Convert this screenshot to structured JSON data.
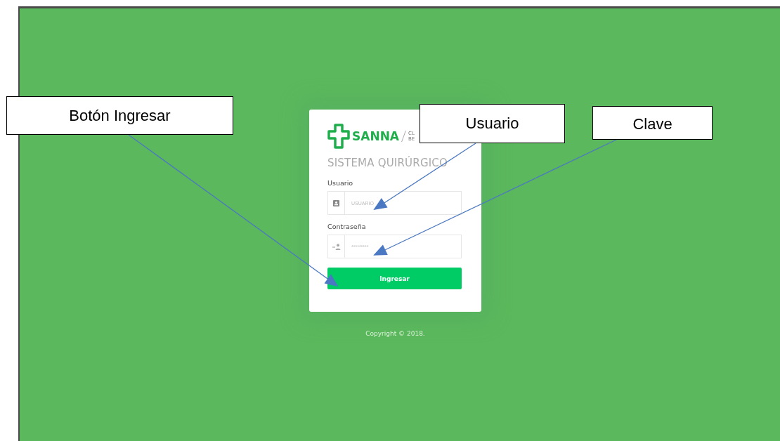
{
  "login": {
    "brand": "SANNA",
    "brand_subtitle_lines": [
      "CL",
      "BE"
    ],
    "system_title": "SISTEMA QUIRÚRGICO",
    "fields": [
      {
        "kind": "user",
        "label": "Usuario",
        "placeholder": "USUARIO"
      },
      {
        "kind": "password",
        "label": "Contraseña",
        "placeholder": "*********"
      }
    ],
    "submit": "Ingresar"
  },
  "copyright": "Copyright © 2018.",
  "callouts": [
    {
      "text": "Botón Ingresar"
    },
    {
      "text": "Usuario"
    },
    {
      "text": "Clave"
    }
  ]
}
